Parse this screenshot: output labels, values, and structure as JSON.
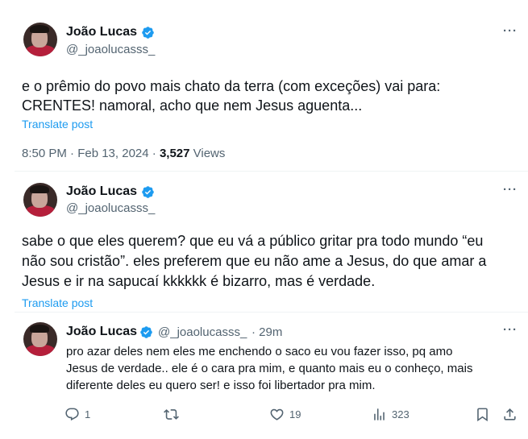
{
  "post1": {
    "author_name": "João Lucas",
    "handle": "@_joaolucasss_",
    "line1": "e o prêmio do povo mais chato da terra (com exceções) vai para:",
    "line2": "CRENTES! namoral, acho que nem Jesus aguenta...",
    "translate": "Translate post",
    "time": "8:50 PM · Feb 13, 2024 · ",
    "views_count": "3,527",
    "views_label": " Views",
    "more": "···"
  },
  "post2": {
    "author_name": "João Lucas",
    "handle": "@_joaolucasss_",
    "line1": "sabe o que eles querem? que eu vá a público gritar pra todo mundo “eu",
    "line2": "não sou cristão”. eles preferem que eu não ame a Jesus, do que amar a",
    "line3": "Jesus e ir na sapucaí kkkkkk é bizarro, mas é verdade.",
    "translate": "Translate post",
    "more": "···"
  },
  "reply": {
    "author_name": "João Lucas",
    "handle": "@_joaolucasss_",
    "time": "· 29m",
    "line1": "pro azar deles nem eles me enchendo o saco eu vou fazer isso, pq amo",
    "line2": "Jesus de verdade.. ele é o cara pra mim, e quanto mais eu o conheço, mais",
    "line3": "diferente deles eu quero ser! e isso foi libertador pra mim.",
    "more": "···",
    "actions": {
      "reply_count": "1",
      "repost_count": "",
      "like_count": "19",
      "views_count": "323"
    }
  },
  "colors": {
    "accent": "#1d9bf0",
    "text": "#0f1419",
    "secondary": "#536471"
  }
}
